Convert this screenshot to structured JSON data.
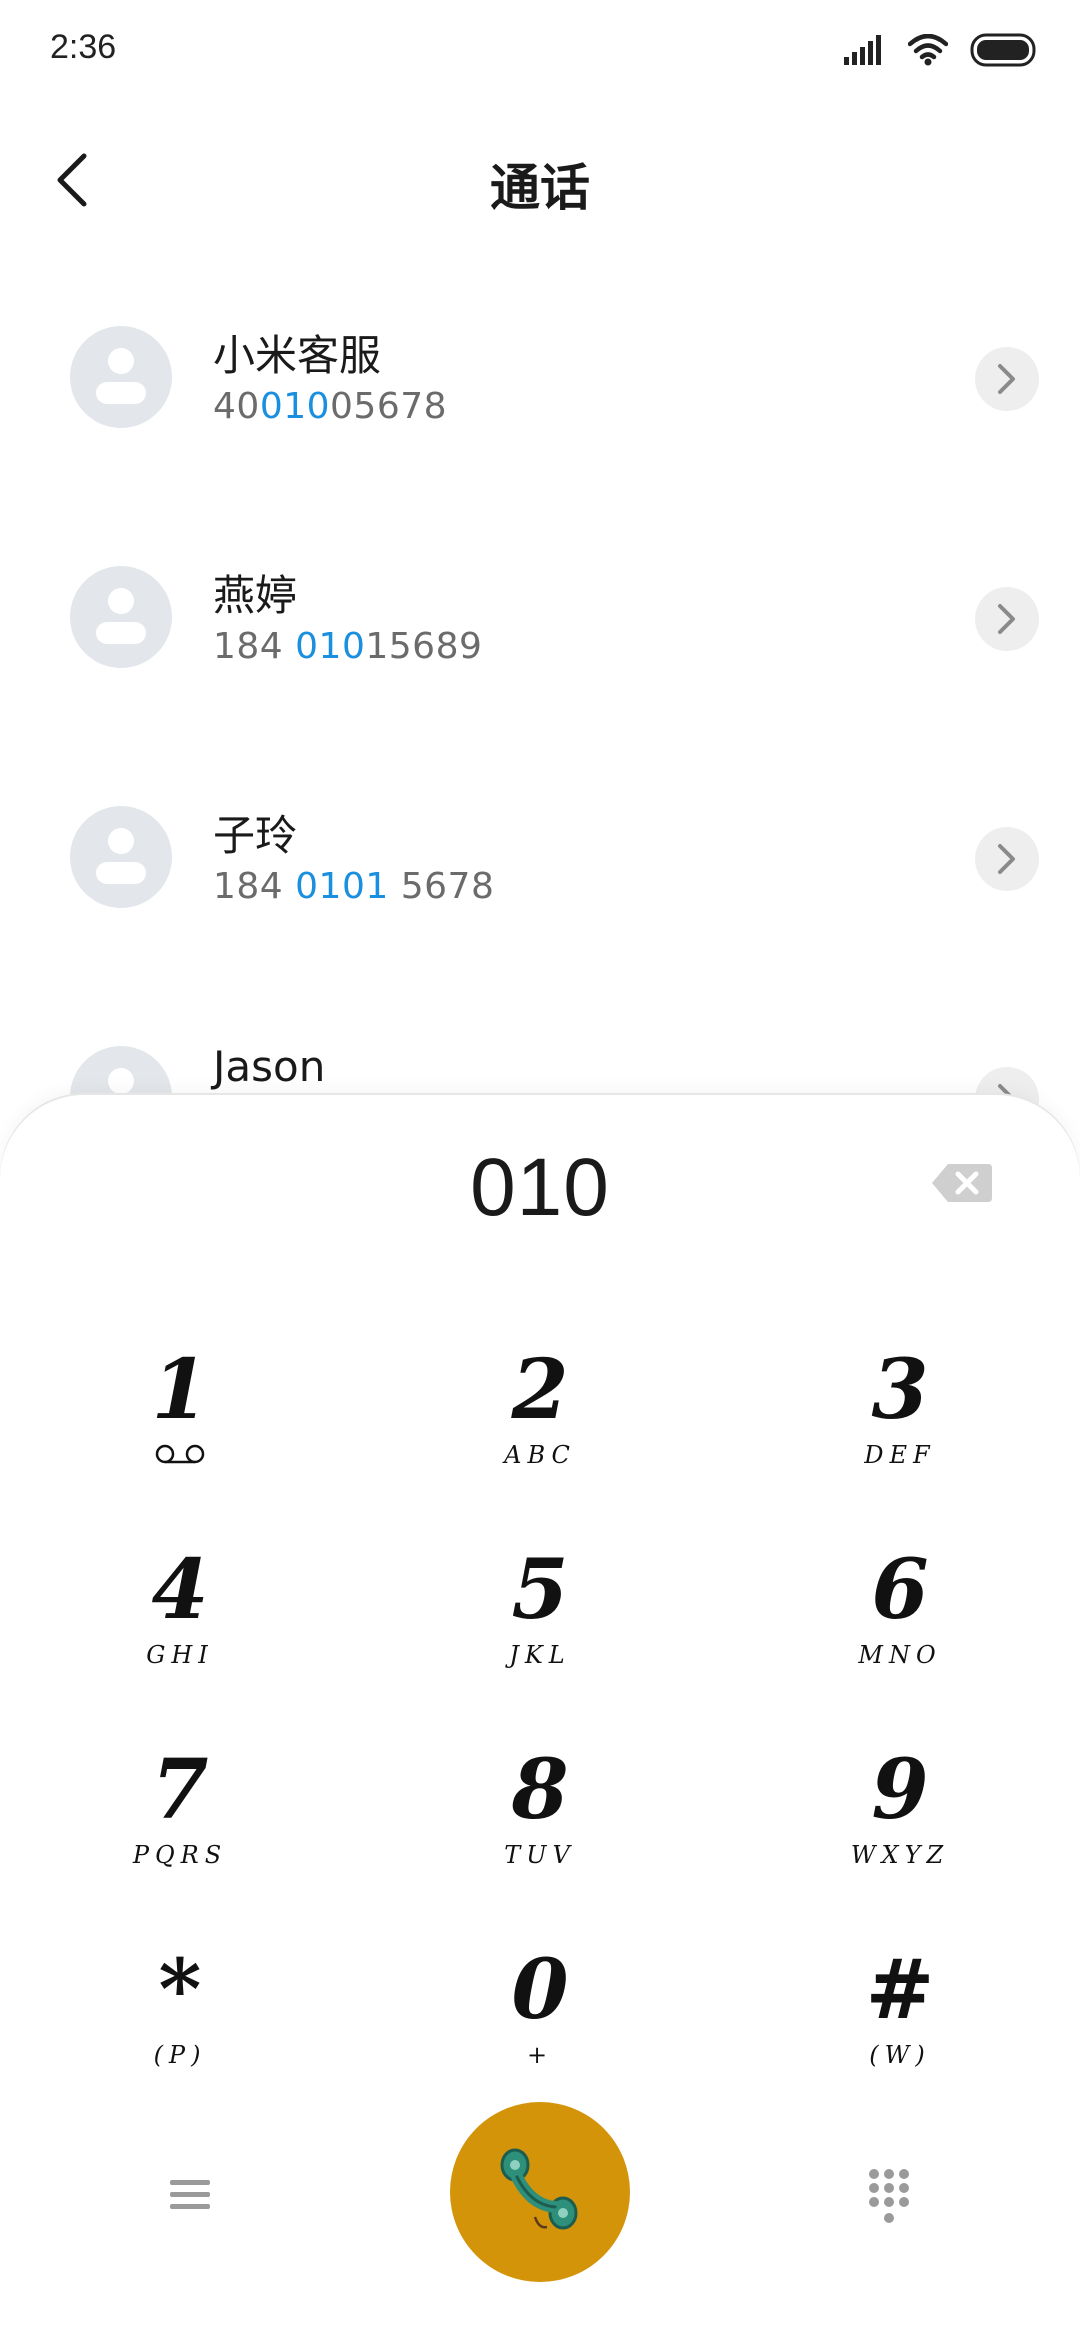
{
  "status_bar": {
    "time": "2:36",
    "icons": [
      "signal-icon",
      "wifi-icon",
      "battery-icon"
    ]
  },
  "header": {
    "title": "通话",
    "back_icon": "chevron-left-icon"
  },
  "contacts": [
    {
      "name": "小米客服",
      "number_pre": "40",
      "number_match": "010",
      "number_post": "05678"
    },
    {
      "name": "燕婷",
      "number_pre": "184 ",
      "number_match": "010",
      "number_post": "15689"
    },
    {
      "name": "子玲",
      "number_pre": "184 ",
      "number_match": "0101",
      "number_post": " 5678"
    },
    {
      "name": "Jason",
      "number_pre": "",
      "number_match": "",
      "number_post": ""
    }
  ],
  "dialpad": {
    "dialed": "010",
    "keys": [
      {
        "digit": "1",
        "letters": ""
      },
      {
        "digit": "2",
        "letters": "ABC"
      },
      {
        "digit": "3",
        "letters": "DEF"
      },
      {
        "digit": "4",
        "letters": "GHI"
      },
      {
        "digit": "5",
        "letters": "JKL"
      },
      {
        "digit": "6",
        "letters": "MNO"
      },
      {
        "digit": "7",
        "letters": "PQRS"
      },
      {
        "digit": "8",
        "letters": "TUV"
      },
      {
        "digit": "9",
        "letters": "WXYZ"
      },
      {
        "digit": "*",
        "letters": "(P)"
      },
      {
        "digit": "0",
        "letters": "+"
      },
      {
        "digit": "#",
        "letters": "(W)"
      }
    ]
  },
  "colors": {
    "match_highlight": "#1a8fe0",
    "call_button": "#d4940a",
    "avatar_bg": "#e3e6ea"
  }
}
